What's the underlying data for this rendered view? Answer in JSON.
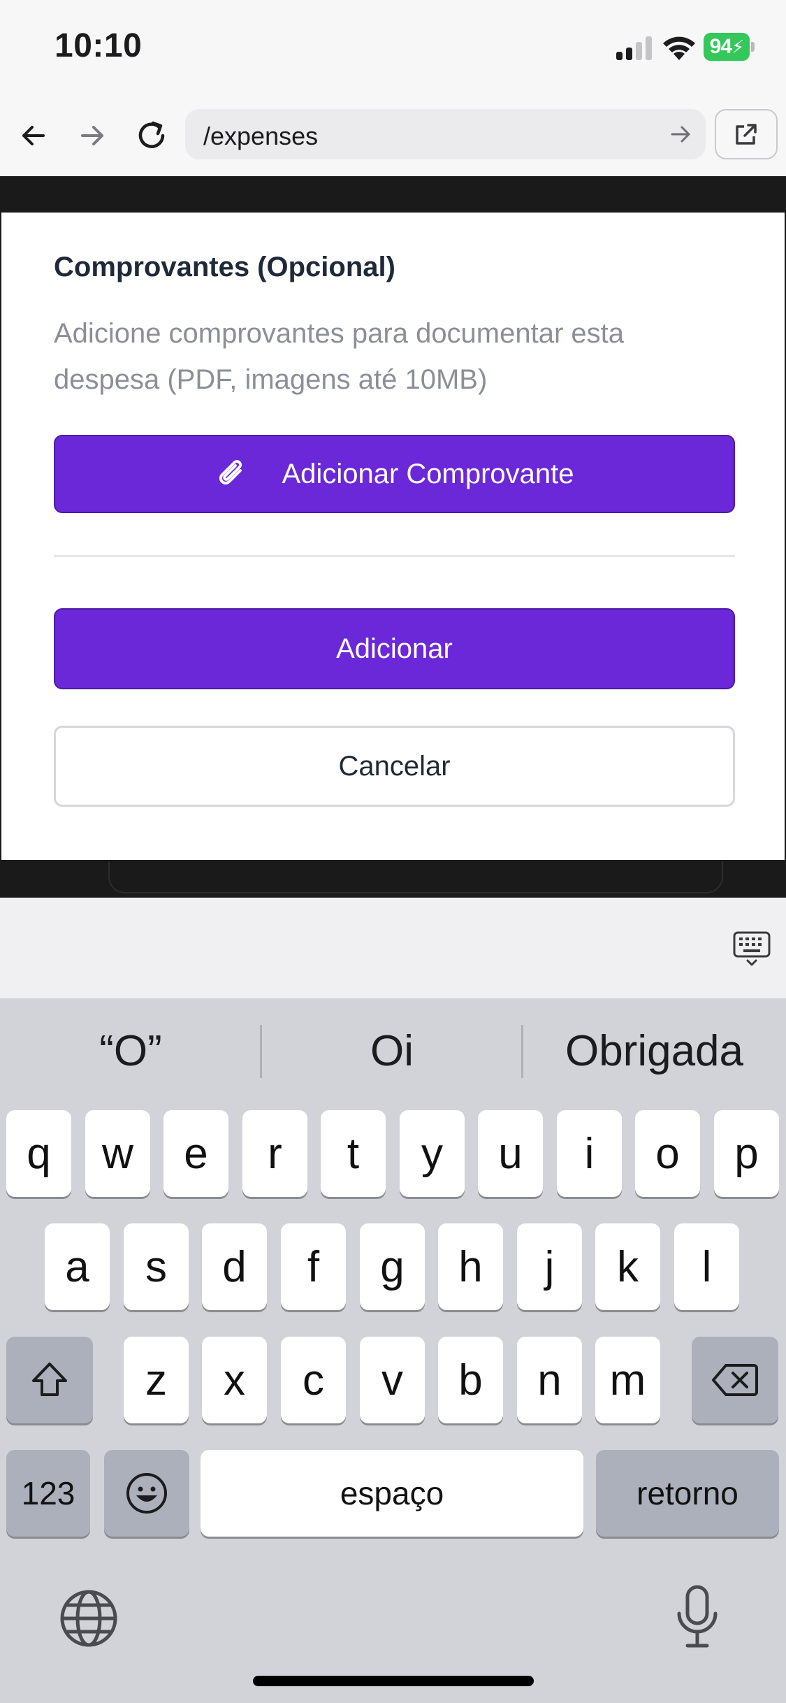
{
  "status_bar": {
    "time": "10:10",
    "battery": "94"
  },
  "browser": {
    "url": "/expenses"
  },
  "form": {
    "attachments_title": "Comprovantes (Opcional)",
    "attachments_description": "Adicione comprovantes para documentar esta despesa (PDF, imagens até 10MB)",
    "add_attachment_label": "Adicionar Comprovante",
    "submit_label": "Adicionar",
    "cancel_label": "Cancelar"
  },
  "keyboard": {
    "suggestions": [
      "“O”",
      "Oi",
      "Obrigada"
    ],
    "row1": [
      "q",
      "w",
      "e",
      "r",
      "t",
      "y",
      "u",
      "i",
      "o",
      "p"
    ],
    "row2": [
      "a",
      "s",
      "d",
      "f",
      "g",
      "h",
      "j",
      "k",
      "l"
    ],
    "row3": [
      "z",
      "x",
      "c",
      "v",
      "b",
      "n",
      "m"
    ],
    "numbers_label": "123",
    "space_label": "espaço",
    "return_label": "retorno"
  },
  "colors": {
    "accent": "#6b28d9",
    "battery": "#34c759",
    "keyboard_bg": "#d1d3d9"
  }
}
